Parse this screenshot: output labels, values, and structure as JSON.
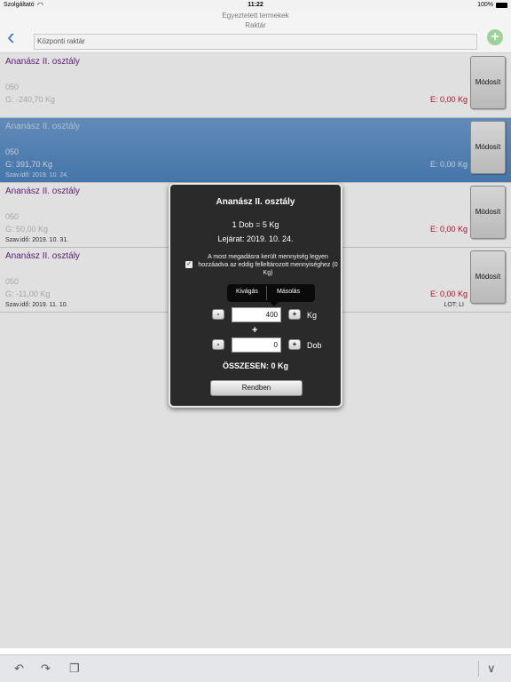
{
  "status_bar": {
    "carrier": "Szolgáltató",
    "time": "11:22",
    "battery": "100%"
  },
  "header": {
    "title": "Egyeztetett termekek",
    "subtitle": "Raktár",
    "warehouse": "Központi raktár"
  },
  "rows": [
    {
      "name": "Ananász II. osztály",
      "code": "050",
      "g": "G: -240,70 Kg",
      "date": "",
      "e": "E: 0,00 Kg",
      "lot": "",
      "button": "Módosít"
    },
    {
      "name": "Ananász II. osztály",
      "code": "050",
      "g": "G: 391,70 Kg",
      "date": "Szav.idő: 2019. 10. 24.",
      "e": "E: 0,00 Kg",
      "lot": "",
      "button": "Módosít"
    },
    {
      "name": "Ananász II. osztály",
      "code": "050",
      "g": "G: 50,00 Kg",
      "date": "Szav.idő: 2019. 10. 31.",
      "e": "E: 0,00 Kg",
      "lot": "",
      "button": "Módosít"
    },
    {
      "name": "Ananász II. osztály",
      "code": "050",
      "g": "G: -11,00 Kg",
      "date": "Szav.idő: 2019. 11. 10.",
      "e": "E: 0,00 Kg",
      "lot": "LOT: LI",
      "button": "Módosít"
    }
  ],
  "popup": {
    "title": "Ananász II. osztály",
    "ratio": "1 Dob = 5 Kg",
    "expiry": "Lejárat: 2019. 10. 24.",
    "checkbox_checked": true,
    "notice": "A most megadásra került mennyiség legyen hozzáadva az eddig felleltározott mennyiséghez (0 Kg)",
    "edit_menu": {
      "cut": "Kivágás",
      "copy": "Másolás"
    },
    "kg_value": "400",
    "kg_unit": "Kg",
    "plus": "+",
    "dob_value": "0",
    "dob_unit": "Dob",
    "minus_label": "-",
    "plus_label": "+",
    "total": "ÖSSZESEN: 0 Kg",
    "ok": "Rendben"
  },
  "colors": {
    "accent": "#3a7ad6",
    "product_name": "#6a2585",
    "e_value": "#c8102e",
    "selected_row": "#5b91c9"
  },
  "icons": {
    "back": "chevron-left-icon",
    "add": "plus-circle-icon",
    "undo": "undo-icon",
    "redo": "redo-icon",
    "paste": "clipboard-icon",
    "dismiss_keyboard": "chevron-down-icon"
  }
}
